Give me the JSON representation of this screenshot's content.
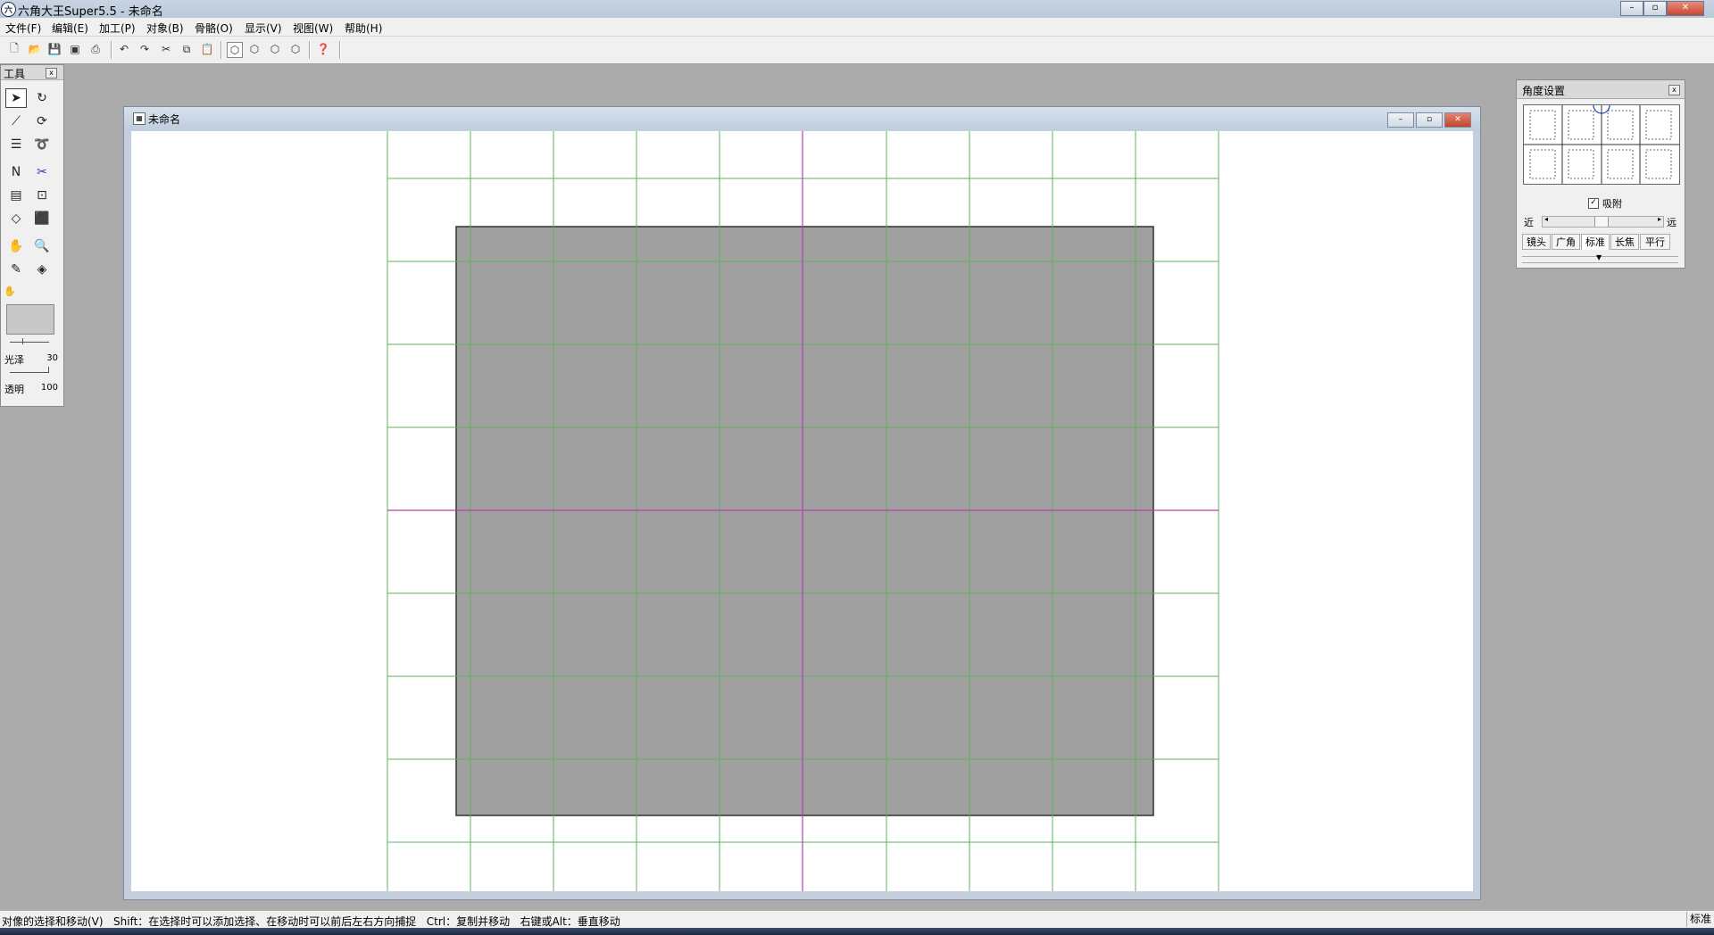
{
  "app": {
    "title": "六角大王Super5.5 - 未命名",
    "icon_text": "六",
    "window_controls": [
      "–",
      "▫",
      "✕"
    ]
  },
  "menu": [
    "文件(F)",
    "编辑(E)",
    "加工(P)",
    "对象(B)",
    "骨骼(O)",
    "显示(V)",
    "视图(W)",
    "帮助(H)"
  ],
  "toolbar": {
    "buttons": [
      "new-icon",
      "open-icon",
      "save-icon",
      "save-all-icon",
      "print-icon",
      "undo-icon",
      "redo-icon",
      "cut-icon",
      "copy-icon",
      "paste-icon",
      "view-front-icon",
      "view-side-icon",
      "view-top-icon",
      "view-3d-icon",
      "help-icon"
    ]
  },
  "tools_panel": {
    "title": "工具",
    "close": "x",
    "gloss_label": "光泽",
    "gloss_value": "30",
    "transparency_label": "透明",
    "transparency_value": "100",
    "swatch_color": "#c8c8c8"
  },
  "document": {
    "title": "未命名",
    "controls": [
      "–",
      "▫",
      "✕"
    ],
    "shape_color": "#a0a0a0",
    "grid_color": "#5fb05f",
    "axis_color": "#b040b0"
  },
  "angle_panel": {
    "title": "角度设置",
    "close": "x",
    "snap_label": "吸附",
    "snap_checked": true,
    "near_label": "近",
    "far_label": "远",
    "lens_tabs": [
      "镜头",
      "广角",
      "标准",
      "长焦",
      "平行"
    ],
    "active_tab": "标准"
  },
  "status": {
    "text": "对像的选择和移动(V)   Shift：在选择时可以添加选择、在移动时可以前后左右方向捕捉   Ctrl：复制并移动   右键或Alt：垂直移动",
    "mode": "标准"
  }
}
